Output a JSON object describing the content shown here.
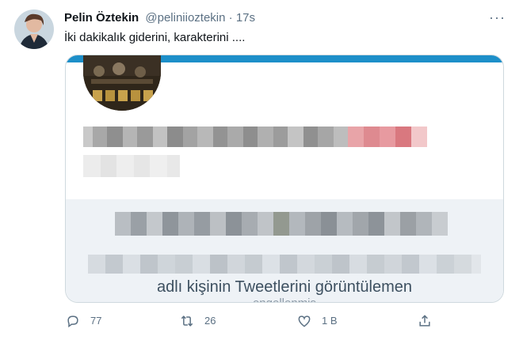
{
  "tweet": {
    "author_name": "Pelin Öztekin",
    "author_handle": "@peliniioztekin",
    "separator": "·",
    "time": "17s",
    "text": "İki dakikalık giderini, karakterini ....",
    "more_icon": "more-icon"
  },
  "embedded_card": {
    "blocked_caption_line1": "adlı kişinin Tweetlerini görüntülemen",
    "blocked_caption_line2": "engellenmiş"
  },
  "actions": {
    "reply_count": "77",
    "retweet_count": "26",
    "like_count": "1 B"
  }
}
